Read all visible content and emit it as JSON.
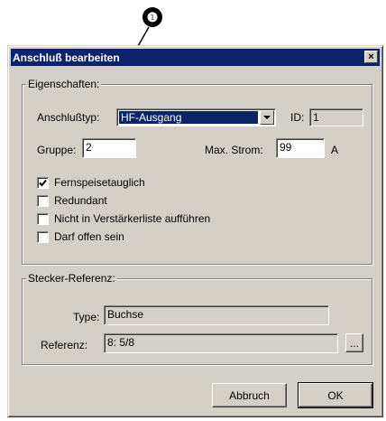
{
  "callout": {
    "number": "❶"
  },
  "dialog": {
    "title": "Anschluß bearbeiten",
    "close_glyph": "×",
    "properties_group": {
      "legend": "Eigenschaften:",
      "type_label": "Anschlußtyp:",
      "type_value": "HF-Ausgang",
      "id_label": "ID:",
      "id_value": "1",
      "group_label": "Gruppe:",
      "group_value": "2",
      "max_current_label": "Max. Strom:",
      "max_current_value": "99",
      "max_current_unit": "A",
      "checkboxes": [
        {
          "label": "Fernspeisetauglich",
          "checked": true
        },
        {
          "label": "Redundant",
          "checked": false
        },
        {
          "label": "Nicht in Verstärkerliste aufführen",
          "checked": false
        },
        {
          "label": "Darf offen sein",
          "checked": false
        }
      ]
    },
    "plug_group": {
      "legend": "Stecker-Referenz:",
      "type_label": "Type:",
      "type_value": "Buchse",
      "reference_label": "Referenz:",
      "reference_value": "8: 5/8",
      "browse_label": "..."
    },
    "buttons": {
      "cancel_label": "Abbruch",
      "ok_label": "OK"
    }
  }
}
